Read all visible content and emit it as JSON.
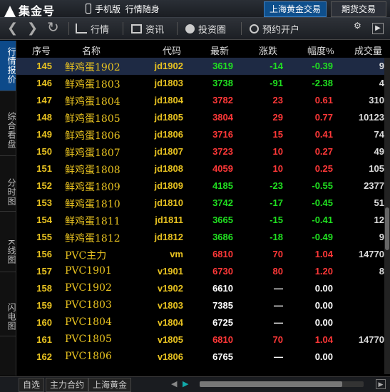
{
  "titlebar": {
    "logo": "集金号",
    "phone_label": "手机版",
    "slogan": "行情随身",
    "tab_shgold": "上海黄金交易",
    "tab_futures": "期货交易"
  },
  "toolbar": {
    "quotes": "行情",
    "news": "资讯",
    "investment": "投资圈",
    "open_account": "预约开户"
  },
  "lefttabs": [
    "行情报价",
    "综合看盘",
    "分时图",
    "K线图",
    "闪电图"
  ],
  "columns": [
    "序号",
    "名称",
    "代码",
    "最新",
    "涨跌",
    "幅度%",
    "成交量"
  ],
  "rows": [
    {
      "idx": "145",
      "name": "鲜鸡蛋1902",
      "code": "jd1902",
      "last": "3619",
      "chg": "-14",
      "pct": "-0.39",
      "vol": "9",
      "dir": "down"
    },
    {
      "idx": "146",
      "name": "鲜鸡蛋1803",
      "code": "jd1803",
      "last": "3738",
      "chg": "-91",
      "pct": "-2.38",
      "vol": "4",
      "dir": "down"
    },
    {
      "idx": "147",
      "name": "鲜鸡蛋1804",
      "code": "jd1804",
      "last": "3782",
      "chg": "23",
      "pct": "0.61",
      "vol": "310",
      "dir": "up"
    },
    {
      "idx": "148",
      "name": "鲜鸡蛋1805",
      "code": "jd1805",
      "last": "3804",
      "chg": "29",
      "pct": "0.77",
      "vol": "10123",
      "dir": "up"
    },
    {
      "idx": "149",
      "name": "鲜鸡蛋1806",
      "code": "jd1806",
      "last": "3716",
      "chg": "15",
      "pct": "0.41",
      "vol": "74",
      "dir": "up"
    },
    {
      "idx": "150",
      "name": "鲜鸡蛋1807",
      "code": "jd1807",
      "last": "3723",
      "chg": "10",
      "pct": "0.27",
      "vol": "49",
      "dir": "up"
    },
    {
      "idx": "151",
      "name": "鲜鸡蛋1808",
      "code": "jd1808",
      "last": "4059",
      "chg": "10",
      "pct": "0.25",
      "vol": "105",
      "dir": "up"
    },
    {
      "idx": "152",
      "name": "鲜鸡蛋1809",
      "code": "jd1809",
      "last": "4185",
      "chg": "-23",
      "pct": "-0.55",
      "vol": "2377",
      "dir": "down"
    },
    {
      "idx": "153",
      "name": "鲜鸡蛋1810",
      "code": "jd1810",
      "last": "3742",
      "chg": "-17",
      "pct": "-0.45",
      "vol": "51",
      "dir": "down"
    },
    {
      "idx": "154",
      "name": "鲜鸡蛋1811",
      "code": "jd1811",
      "last": "3665",
      "chg": "-15",
      "pct": "-0.41",
      "vol": "12",
      "dir": "down"
    },
    {
      "idx": "155",
      "name": "鲜鸡蛋1812",
      "code": "jd1812",
      "last": "3686",
      "chg": "-18",
      "pct": "-0.49",
      "vol": "9",
      "dir": "down"
    },
    {
      "idx": "156",
      "name": "PVC主力",
      "code": "vm",
      "last": "6810",
      "chg": "70",
      "pct": "1.04",
      "vol": "14770",
      "dir": "up"
    },
    {
      "idx": "157",
      "name": "PVC1901",
      "code": "v1901",
      "last": "6730",
      "chg": "80",
      "pct": "1.20",
      "vol": "8",
      "dir": "up"
    },
    {
      "idx": "158",
      "name": "PVC1902",
      "code": "v1902",
      "last": "6610",
      "chg": "—",
      "pct": "0.00",
      "vol": "",
      "dir": "flat"
    },
    {
      "idx": "159",
      "name": "PVC1803",
      "code": "v1803",
      "last": "7385",
      "chg": "—",
      "pct": "0.00",
      "vol": "",
      "dir": "flat"
    },
    {
      "idx": "160",
      "name": "PVC1804",
      "code": "v1804",
      "last": "6725",
      "chg": "—",
      "pct": "0.00",
      "vol": "",
      "dir": "flat"
    },
    {
      "idx": "161",
      "name": "PVC1805",
      "code": "v1805",
      "last": "6810",
      "chg": "70",
      "pct": "1.04",
      "vol": "14770",
      "dir": "up"
    },
    {
      "idx": "162",
      "name": "PVC1806",
      "code": "v1806",
      "last": "6765",
      "chg": "—",
      "pct": "0.00",
      "vol": "",
      "dir": "flat"
    }
  ],
  "bottom_tabs": [
    "自选",
    "主力合约",
    "上海黄金"
  ],
  "colors": {
    "up": "#ff3838",
    "down": "#20e020",
    "accent": "#e8c220",
    "active_tab": "#0d4a8a"
  }
}
